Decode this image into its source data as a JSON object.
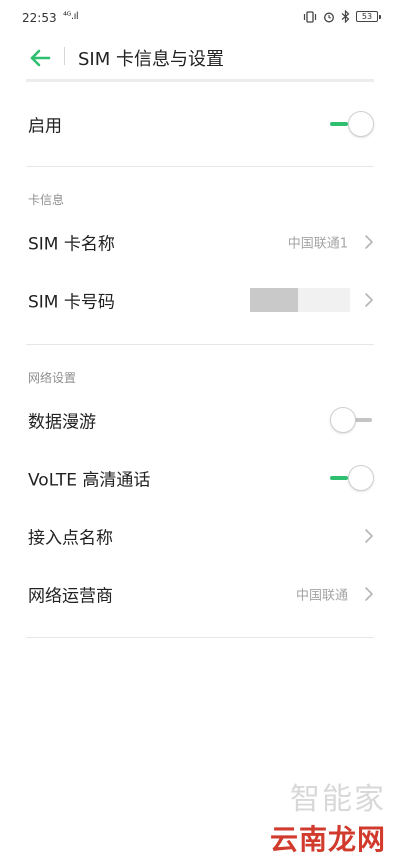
{
  "status_bar": {
    "time": "22:53",
    "signal_text": "⁴ᴳ.ıl",
    "battery": "53"
  },
  "header": {
    "title": "SIM 卡信息与设置"
  },
  "enable_row": {
    "label": "启用",
    "enabled": true
  },
  "card_info_section": {
    "title": "卡信息",
    "sim_name": {
      "label": "SIM 卡名称",
      "value": "中国联通1"
    },
    "sim_number": {
      "label": "SIM 卡号码",
      "value": ""
    }
  },
  "network_section": {
    "title": "网络设置",
    "data_roaming": {
      "label": "数据漫游",
      "enabled": false
    },
    "volte": {
      "label": "VoLTE 高清通话",
      "enabled": true
    },
    "apn": {
      "label": "接入点名称"
    },
    "carrier": {
      "label": "网络运营商",
      "value": "中国联通"
    }
  },
  "watermark": {
    "top": "智能家",
    "bottom": "云南龙网"
  },
  "colors": {
    "accent": "#2fbf71",
    "background": "#ffffff",
    "text": "#222222",
    "secondary_text": "#a4a4a4",
    "watermark_red": "#d03b2d"
  }
}
